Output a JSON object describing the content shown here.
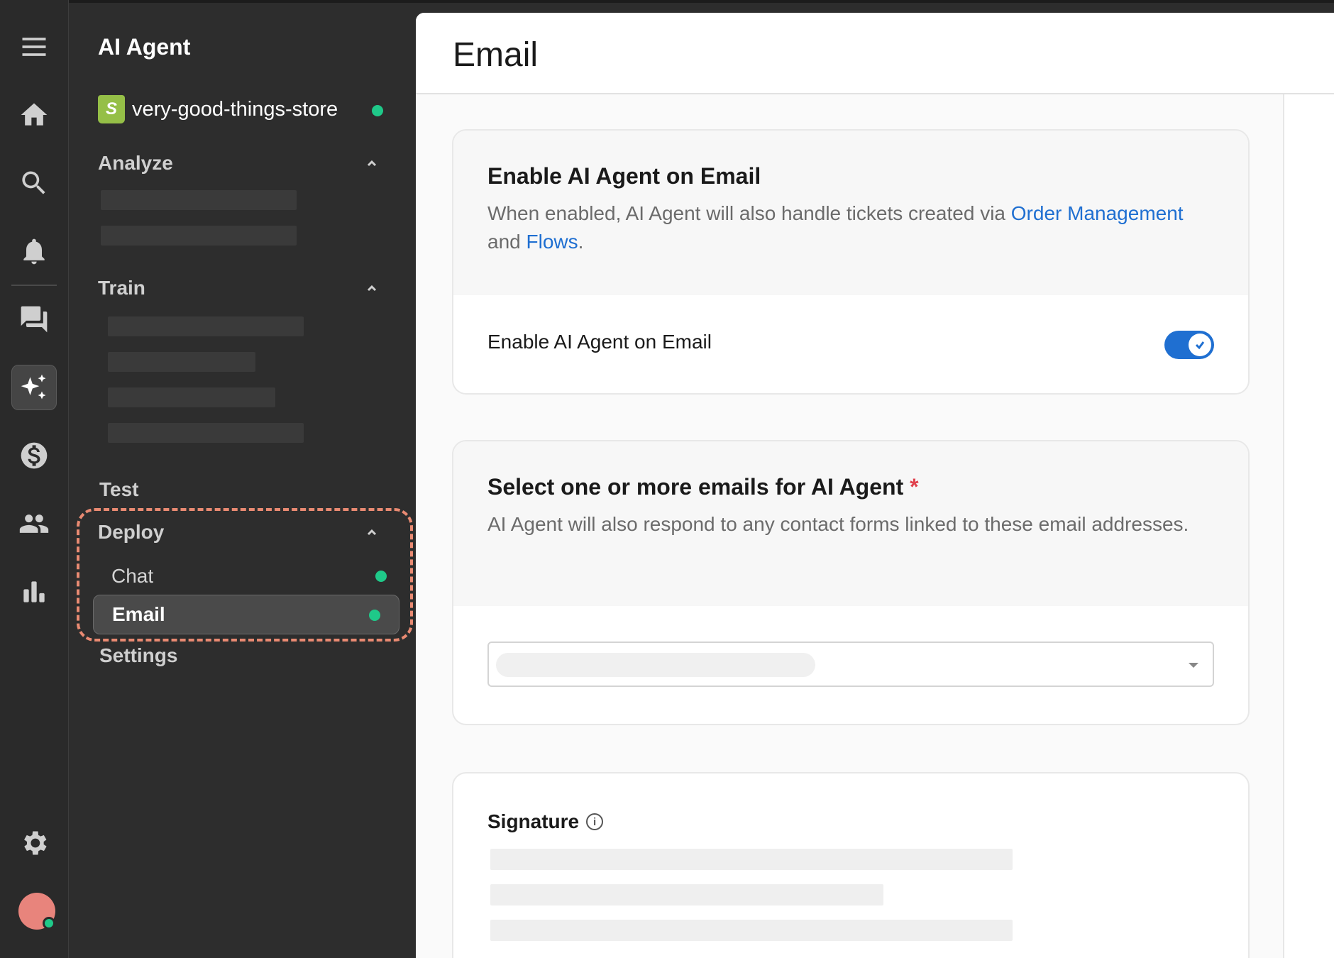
{
  "rail": {
    "items": [
      {
        "name": "menu-icon"
      },
      {
        "name": "home-icon"
      },
      {
        "name": "search-icon"
      },
      {
        "name": "bell-icon"
      },
      {
        "name": "chat-icon"
      },
      {
        "name": "ai-sparkle-icon"
      },
      {
        "name": "dollar-icon"
      },
      {
        "name": "users-icon"
      },
      {
        "name": "stats-icon"
      },
      {
        "name": "gear-icon"
      }
    ],
    "active": "ai-sparkle-icon"
  },
  "nav": {
    "title": "AI Agent",
    "store": {
      "bag_letter": "S",
      "name": "very-good-things-store"
    },
    "sections": {
      "analyze": "Analyze",
      "train": "Train",
      "test": "Test",
      "deploy": "Deploy",
      "settings": "Settings"
    },
    "deploy_items": [
      {
        "label": "Chat",
        "active": false
      },
      {
        "label": "Email",
        "active": true
      }
    ]
  },
  "main": {
    "title": "Email",
    "enable_card": {
      "title": "Enable AI Agent on Email",
      "desc_prefix": "When enabled, AI Agent will also handle tickets created via",
      "link_order_management": "Order Management",
      "desc_and": "and",
      "link_flows": "Flows",
      "desc_suffix": ".",
      "toggle_label": "Enable AI Agent on Email",
      "toggle_on": true
    },
    "emails_card": {
      "title": "Select one or more emails for AI Agent",
      "required_mark": "*",
      "desc": "AI Agent will also respond to any contact forms linked to these email addresses."
    },
    "signature_card": {
      "title": "Signature",
      "info_glyph": "i"
    }
  },
  "colors": {
    "accent_blue": "#1f6fd1",
    "status_green": "#1fc989",
    "highlight_dashed": "#e98a72",
    "required_red": "#e0414d"
  }
}
